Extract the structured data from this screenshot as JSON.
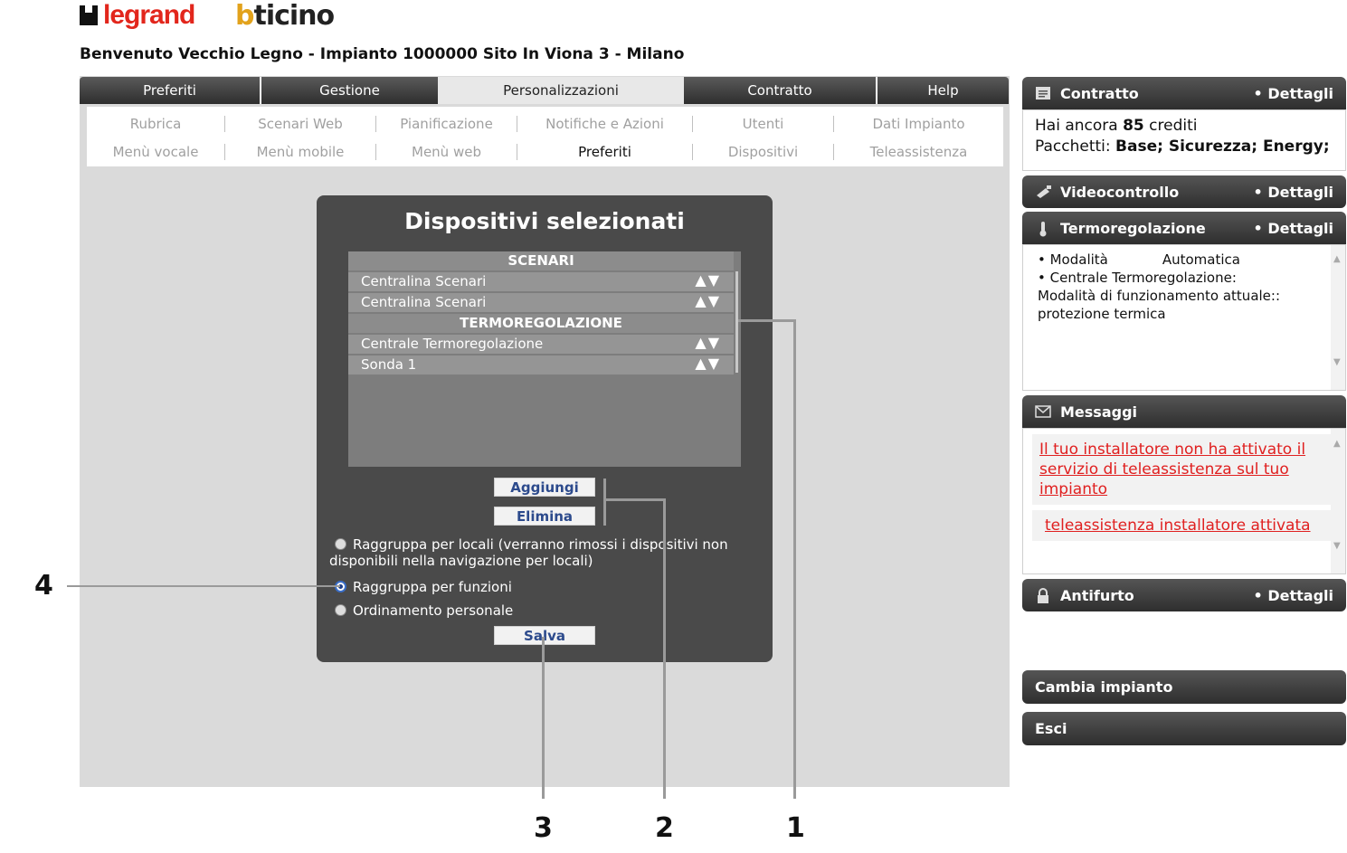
{
  "logos": {
    "legrand": "legrand",
    "bticino_b": "b",
    "bticino_rest": "ticino"
  },
  "welcome": "Benvenuto Vecchio Legno - Impianto 1000000 Sito In Viona 3 - Milano",
  "tabs": [
    {
      "label": "Preferiti"
    },
    {
      "label": "Gestione"
    },
    {
      "label": "Personalizzazioni"
    },
    {
      "label": "Contratto"
    },
    {
      "label": "Help"
    }
  ],
  "subnav": {
    "row1": [
      "Rubrica",
      "Scenari Web",
      "Pianificazione",
      "Notifiche e Azioni",
      "Utenti",
      "Dati Impianto"
    ],
    "row2": [
      "Menù vocale",
      "Menù mobile",
      "Menù web",
      "Preferiti",
      "Dispositivi",
      "Teleassistenza"
    ]
  },
  "panel": {
    "title": "Dispositivi selezionati",
    "list": [
      {
        "type": "header",
        "label": "SCENARI"
      },
      {
        "type": "item",
        "label": "Centralina Scenari",
        "arrows": "▲▼"
      },
      {
        "type": "item",
        "label": "Centralina Scenari",
        "arrows": "▲▼"
      },
      {
        "type": "header",
        "label": "TERMOREGOLAZIONE"
      },
      {
        "type": "item",
        "label": "Centrale Termoregolazione",
        "arrows": "▲▼"
      },
      {
        "type": "item",
        "label": "Sonda 1",
        "arrows": "▲▼"
      }
    ],
    "add_label": "Aggiungi",
    "remove_label": "Elimina",
    "radio_locali_line1": "Raggruppa per locali (verranno rimossi i dispositivi non",
    "radio_locali_line2": "disponibili nella navigazione per locali)",
    "radio_funzioni": "Raggruppa per funzioni",
    "radio_personale": "Ordinamento personale",
    "save_label": "Salva"
  },
  "callouts": {
    "n1": "1",
    "n2": "2",
    "n3": "3",
    "n4": "4"
  },
  "contratto": {
    "title": "Contratto",
    "details": "• Dettagli",
    "credits_pre": "Hai ancora ",
    "credits_value": "85",
    "credits_post": " crediti",
    "packages_label": "Pacchetti: ",
    "packages_value": "Base; Sicurezza; Energy;"
  },
  "videocontrollo": {
    "title": "Videocontrollo",
    "details": "• Dettagli"
  },
  "termoregolazione": {
    "title": "Termoregolazione",
    "details": "• Dettagli",
    "mode_label": "• Modalità",
    "mode_value": "Automatica",
    "line2": "• Centrale Termoregolazione:",
    "line3": "Modalità di funzionamento attuale::",
    "line4": "protezione termica"
  },
  "messaggi": {
    "title": "Messaggi",
    "msg1": "Il tuo installatore non ha attivato il servizio di teleassistenza sul tuo impianto",
    "msg2": "teleassistenza installatore attivata"
  },
  "antifurto": {
    "title": "Antifurto",
    "details": "• Dettagli"
  },
  "side_buttons": {
    "cambia": "Cambia impianto",
    "esci": "Esci"
  }
}
